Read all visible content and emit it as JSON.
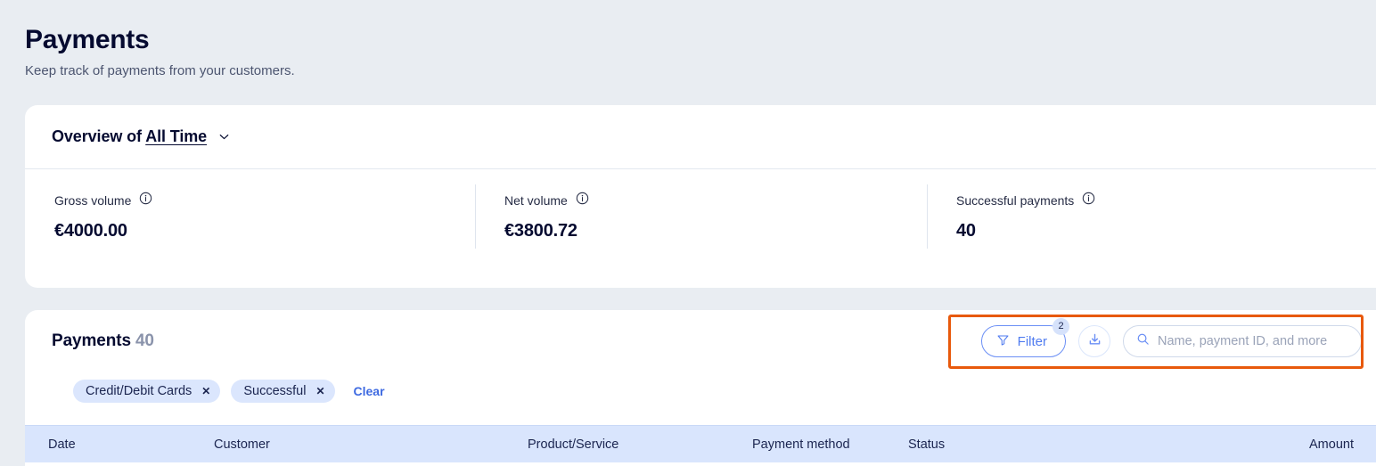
{
  "page": {
    "title": "Payments",
    "subtitle": "Keep track of payments from your customers."
  },
  "overview": {
    "heading_prefix": "Overview of ",
    "period": "All Time",
    "chevron_icon": "chevron-down-icon",
    "metrics": [
      {
        "label": "Gross volume",
        "value": "€4000.00",
        "info_icon": "info-icon"
      },
      {
        "label": "Net volume",
        "value": "€3800.72",
        "info_icon": "info-icon"
      },
      {
        "label": "Successful payments",
        "value": "40",
        "info_icon": "info-icon"
      }
    ]
  },
  "payments": {
    "title": "Payments",
    "count": "40",
    "toolbar": {
      "filter_label": "Filter",
      "filter_badge": "2",
      "filter_icon": "funnel-icon",
      "download_icon": "download-icon",
      "search_icon": "search-icon",
      "search_placeholder": "Name, payment ID, and more",
      "search_value": ""
    },
    "chips": [
      {
        "label": "Credit/Debit Cards",
        "remove_icon": "close-icon"
      },
      {
        "label": "Successful",
        "remove_icon": "close-icon"
      }
    ],
    "clear_label": "Clear",
    "columns": {
      "date": "Date",
      "customer": "Customer",
      "product": "Product/Service",
      "method": "Payment method",
      "status": "Status",
      "amount": "Amount"
    }
  },
  "colors": {
    "page_background": "#e9edf2",
    "card_background": "#ffffff",
    "accent_blue": "#4f7bf0",
    "link_blue": "#3e6ae1",
    "chip_background": "#dbe6fd",
    "table_header_background": "#d9e5fd",
    "highlight_border": "#e8590c",
    "title_text": "#050a30",
    "muted_text": "#8a93ab"
  }
}
